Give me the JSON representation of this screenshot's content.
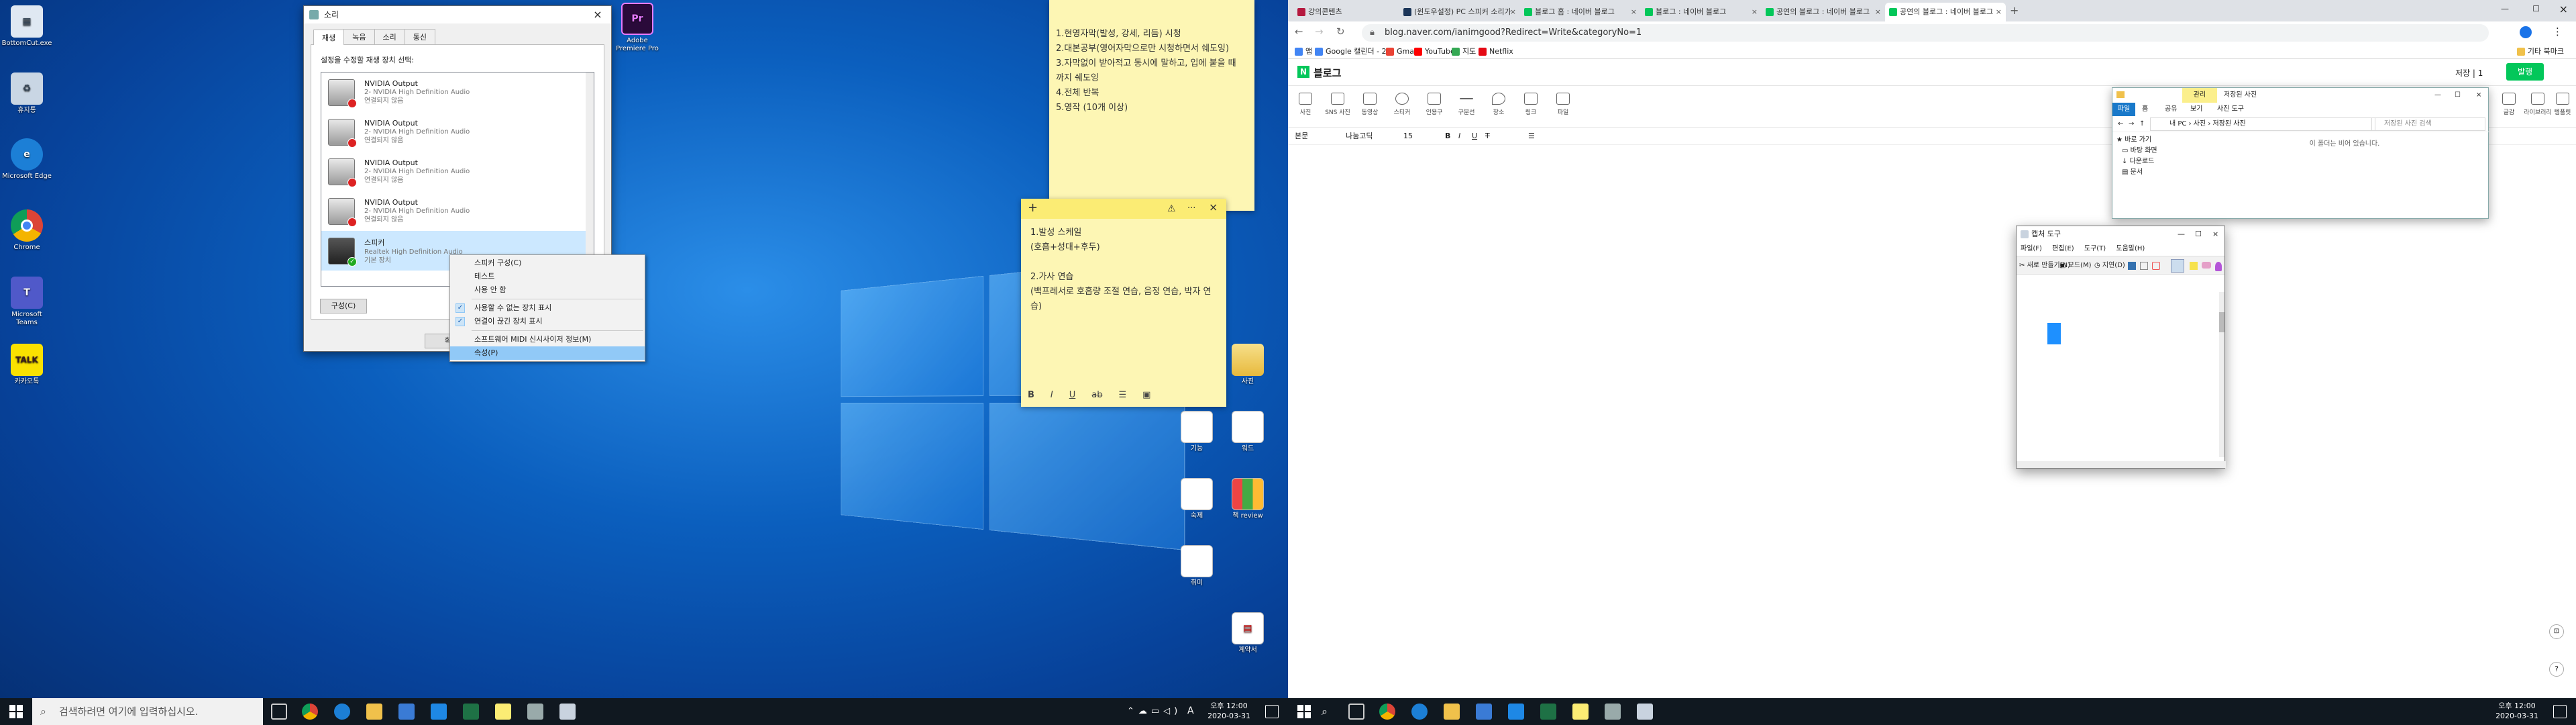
{
  "left": {
    "desktop_icons": [
      {
        "label": "BottomCut.exe",
        "icon": "app-icon"
      },
      {
        "label": "휴지통",
        "icon": "recycle-bin-icon"
      },
      {
        "label": "Microsoft Edge",
        "icon": "edge-icon"
      },
      {
        "label": "Chrome",
        "icon": "chrome-icon"
      },
      {
        "label": "Microsoft Teams",
        "icon": "teams-icon"
      },
      {
        "label": "카카오톡",
        "icon": "kakaotalk-icon"
      },
      {
        "label": "Adobe Premiere Pro",
        "icon": "premiere-icon"
      },
      {
        "label": "사진",
        "icon": "folder-icon"
      },
      {
        "label": "기능",
        "icon": "file-icon"
      },
      {
        "label": "워드",
        "icon": "file-icon"
      },
      {
        "label": "숙제",
        "icon": "file-icon"
      },
      {
        "label": "책 review",
        "icon": "file-icon"
      },
      {
        "label": "취미",
        "icon": "file-icon"
      },
      {
        "label": "계약서",
        "icon": "pdf-icon"
      }
    ],
    "sound_dialog": {
      "title": "소리",
      "close": "×",
      "tabs": [
        "재생",
        "녹음",
        "소리",
        "통신"
      ],
      "instruction": "설정을 수정할 재생 장치 선택:",
      "devices": [
        {
          "name": "NVIDIA Output",
          "sub": "2- NVIDIA High Definition Audio",
          "status": "연결되지 않음"
        },
        {
          "name": "NVIDIA Output",
          "sub": "2- NVIDIA High Definition Audio",
          "status": "연결되지 않음"
        },
        {
          "name": "NVIDIA Output",
          "sub": "2- NVIDIA High Definition Audio",
          "status": "연결되지 않음"
        },
        {
          "name": "NVIDIA Output",
          "sub": "2- NVIDIA High Definition Audio",
          "status": "연결되지 않음"
        },
        {
          "name": "스피커",
          "sub": "Realtek High Definition Audio",
          "status": "기본 장치"
        }
      ],
      "configure_btn": "구성(C)",
      "ok_btn": "확인"
    },
    "context_menu": {
      "items": [
        "스피커 구성(C)",
        "테스트",
        "사용 안 함"
      ],
      "checks": [
        "사용할 수 없는 장치 표시",
        "연결이 끊긴 장치 표시"
      ],
      "info": "소프트웨어 MIDI 신시사이저 정보(M)",
      "props": "속성(P)"
    },
    "note1": {
      "lines": [
        "1.현영자막(발성, 강세, 리듬) 시청",
        "2.대본공부(영어자막으로만 시청하면서 쉐도잉)",
        "3.자막없이 받아적고 동시에 말하고, 입에 붙을 때까지 쉐도잉",
        "4.전체 반복",
        "5.영작 (10개 이상)"
      ]
    },
    "note2": {
      "lines": [
        "1.발성 스케일",
        "(호흡+성대+후두)",
        "",
        "2.가사 연습",
        "(백프레서로 호흡량 조절 연습, 음정 연습, 박자 연습)"
      ],
      "add": "+",
      "more": "···",
      "close": "×",
      "format": [
        "B",
        "I",
        "U",
        "ab",
        "☰",
        "▣"
      ]
    },
    "taskbar": {
      "search_placeholder": "검색하려면 여기에 입력하십시오.",
      "time": "오후 12:00",
      "date": "2020-03-31",
      "ime": "A"
    }
  },
  "right": {
    "tabs": [
      {
        "label": "강의콘텐츠",
        "color": "#b5193f"
      },
      {
        "label": "(윈도우설정) PC 스피커 소리가",
        "color": "#1b3558"
      },
      {
        "label": "블로그 홈 : 네이버 블로그",
        "color": "#03c75a"
      },
      {
        "label": "블로그 : 네이버 블로그",
        "color": "#03c75a"
      },
      {
        "label": "공연의 블로그 : 네이버 블로그",
        "color": "#03c75a"
      },
      {
        "label": "공연의 블로그 : 네이버 블로그",
        "color": "#03c75a"
      }
    ],
    "url": "blog.naver.com/ianimgood?Redirect=Write&categoryNo=1",
    "bookmarks": [
      "앱",
      "Google 캘린더 - 2...",
      "Gmail",
      "YouTube",
      "지도",
      "Netflix",
      "기타 북마크"
    ],
    "blog_logo": "블로그",
    "save_label": "저장",
    "save_count": "1",
    "publish_btn": "발행",
    "tools": [
      "사진",
      "SNS 사진",
      "동영상",
      "스티커",
      "인용구",
      "구분선",
      "장소",
      "링크",
      "파일"
    ],
    "right_tools": [
      "글감",
      "라이브러리",
      "템플릿"
    ],
    "format": {
      "font_style": "본문",
      "font": "나눔고딕",
      "size": "15"
    },
    "explorer": {
      "title": "저장된 사진",
      "ribbon_group": "관리",
      "ribbon_tabs": [
        "파일",
        "홈",
        "공유",
        "보기",
        "사진 도구"
      ],
      "path": [
        "내 PC",
        "사진",
        "저장된 사진"
      ],
      "search": "저장된 사진 검색",
      "nav": [
        "바로 가기",
        "바탕 화면",
        "다운로드",
        "문서"
      ],
      "empty": "이 폴더는 비어 있습니다."
    },
    "snip": {
      "title": "캡처 도구",
      "menus": [
        "파일(F)",
        "편집(E)",
        "도구(T)",
        "도움말(H)"
      ],
      "new_btn": "새로 만들기(N)",
      "mode_btn": "모드(M)",
      "delay_btn": "지연(D)"
    },
    "taskbar": {
      "time": "오후 12:00",
      "date": "2020-03-31"
    }
  }
}
